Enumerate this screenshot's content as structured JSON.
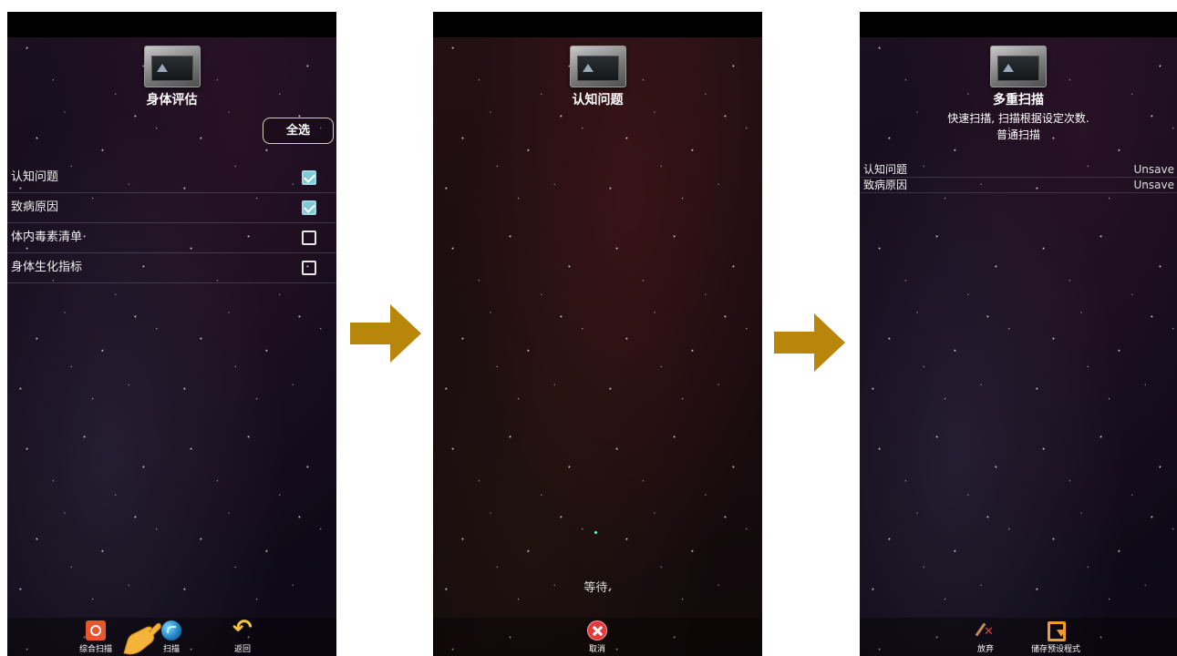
{
  "screen1": {
    "title": "身体评估",
    "select_all_label": "全选",
    "items": [
      {
        "label": "认知问题",
        "checked": true
      },
      {
        "label": "致病原因",
        "checked": true
      },
      {
        "label": "体内毒素清单",
        "checked": false
      },
      {
        "label": "身体生化指标",
        "checked": false
      }
    ],
    "bottom_bar": {
      "combined_scan_label": "综合扫描",
      "scan_label": "扫描",
      "return_label": "返回"
    }
  },
  "screen2": {
    "title": "认知问题",
    "waiting_text": "等待.",
    "cancel_label": "取消"
  },
  "screen3": {
    "title": "多重扫描",
    "subtitle_line1": "快速扫描, 扫描根据设定次数.",
    "subtitle_line2": "普通扫描",
    "items": [
      {
        "label": "认知问题",
        "status": "Unsave"
      },
      {
        "label": "致病原因",
        "status": "Unsave"
      }
    ],
    "bottom_bar": {
      "discard_label": "放弃",
      "save_preset_label": "储存预设程式"
    }
  },
  "colors": {
    "arrow": "#b8860b",
    "checkbox_checked": "#7fc8d6",
    "title": "#ffffff"
  }
}
